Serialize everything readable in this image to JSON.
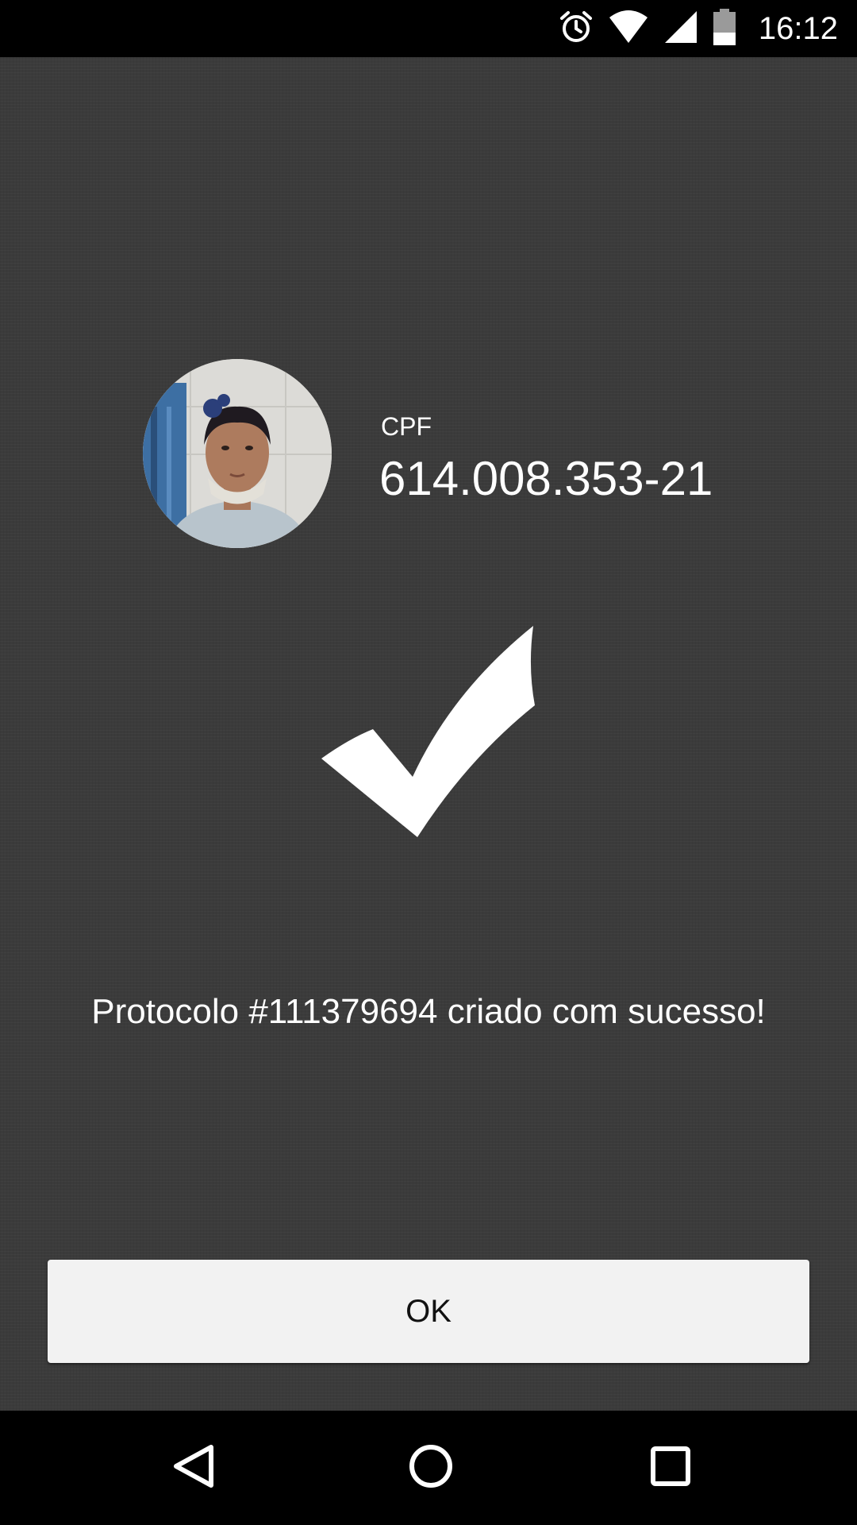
{
  "status_bar": {
    "time": "16:12",
    "icons": [
      "alarm-icon",
      "wifi-icon",
      "signal-icon",
      "battery-icon"
    ]
  },
  "profile": {
    "cpf_label": "CPF",
    "cpf_value": "614.008.353-21"
  },
  "result": {
    "message": "Protocolo #111379694 criado com sucesso!",
    "icon": "checkmark-icon"
  },
  "actions": {
    "ok_label": "OK"
  },
  "nav_bar": {
    "buttons": [
      "back-icon",
      "home-icon",
      "recents-icon"
    ]
  },
  "colors": {
    "background": "#3b3b3b",
    "bars": "#000000",
    "button": "#f2f2f2",
    "text": "#ffffff"
  }
}
